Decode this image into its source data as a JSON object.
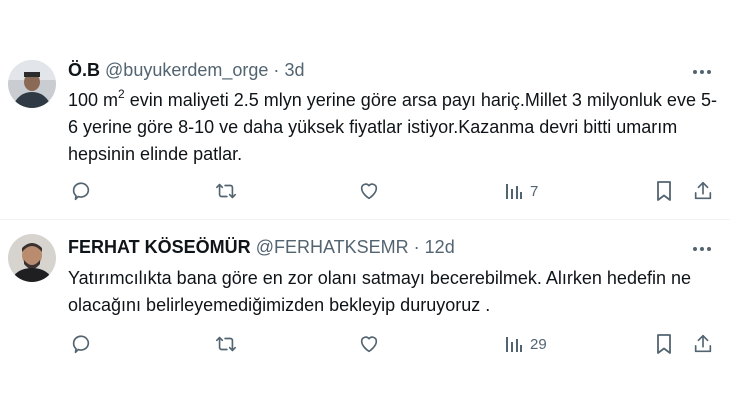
{
  "tweets": [
    {
      "name": "Ö.B",
      "handle": "@buyukerdem_orge",
      "dot": "·",
      "time": "3d",
      "text_part1": "100 m",
      "text_sup": "2",
      "text_part2": " evin maliyeti 2.5 mlyn yerine göre arsa payı hariç.Millet 3 milyonluk eve 5-6 yerine göre 8-10 ve daha yüksek fiyatlar istiyor.Kazanma devri bitti umarım hepsinin elinde patlar.",
      "views": "7"
    },
    {
      "name": "FERHAT KÖSEÖMÜR",
      "handle": "@FERHATKSEMR",
      "dot": "·",
      "time": "12d",
      "text": "Yatırımcılıkta bana göre en zor olanı satmayı becerebilmek. Alırken hedefin ne olacağını belirleyemediğimizden bekleyip duruyoruz .",
      "views": "29"
    }
  ],
  "icons": {
    "more": "more-dots-icon",
    "reply": "reply-icon",
    "retweet": "retweet-icon",
    "like": "heart-icon",
    "views": "views-chart-icon",
    "bookmark": "bookmark-icon",
    "share": "share-icon"
  },
  "colors": {
    "text": "#0f1419",
    "secondary": "#536471",
    "separator": "#eff3f4"
  }
}
